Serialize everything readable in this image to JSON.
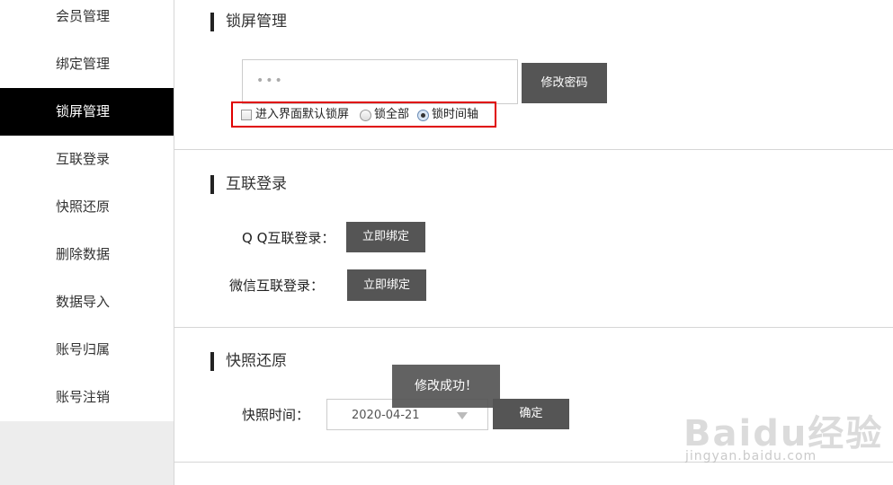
{
  "sidebar": {
    "items": [
      {
        "label": "会员管理",
        "active": false
      },
      {
        "label": "绑定管理",
        "active": false
      },
      {
        "label": "锁屏管理",
        "active": true
      },
      {
        "label": "互联登录",
        "active": false
      },
      {
        "label": "快照还原",
        "active": false
      },
      {
        "label": "删除数据",
        "active": false
      },
      {
        "label": "数据导入",
        "active": false
      },
      {
        "label": "账号归属",
        "active": false
      },
      {
        "label": "账号注销",
        "active": false
      }
    ]
  },
  "lock_screen": {
    "title": "锁屏管理",
    "password_value": "•••",
    "change_password_button": "修改密码",
    "options": {
      "default_lock_checkbox": {
        "label": "进入界面默认锁屏",
        "checked": false
      },
      "lock_all_radio": {
        "label": "锁全部",
        "checked": false
      },
      "lock_timeline_radio": {
        "label": "锁时间轴",
        "checked": true
      }
    }
  },
  "social_login": {
    "title": "互联登录",
    "qq_label": "Q Q互联登录：",
    "qq_button": "立即绑定",
    "wechat_label": "微信互联登录：",
    "wechat_button": "立即绑定"
  },
  "snapshot": {
    "title": "快照还原",
    "time_label": "快照时间：",
    "selected_date": "2020-04-21",
    "confirm_button": "确定"
  },
  "toast": {
    "message": "修改成功！"
  },
  "watermark": {
    "brand": "Baidu经验",
    "url": "jingyan.baidu.com"
  },
  "colors": {
    "active_nav_bg": "#000000",
    "button_bg": "#555555",
    "highlight_border": "#e00000"
  }
}
